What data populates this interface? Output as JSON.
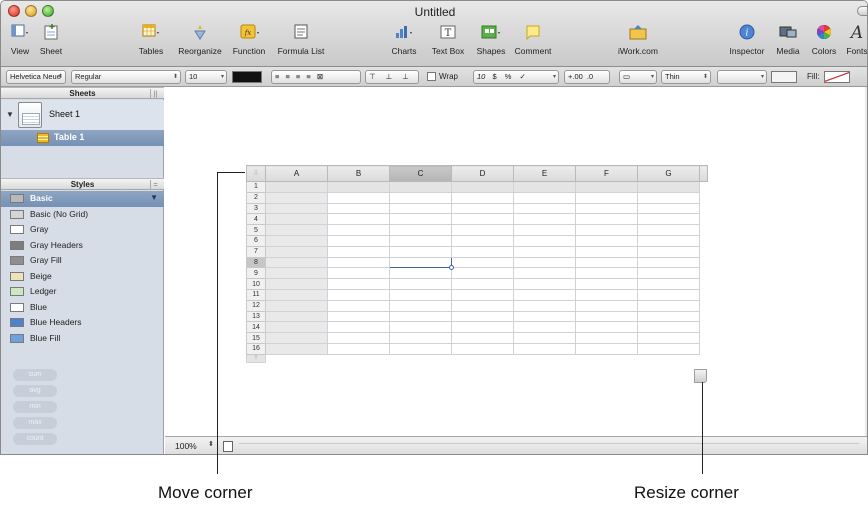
{
  "window": {
    "title": "Untitled"
  },
  "toolbar": {
    "items": [
      {
        "label": "View",
        "icon": "view-icon"
      },
      {
        "label": "Sheet",
        "icon": "sheet-icon"
      },
      {
        "label": "Tables",
        "icon": "tables-icon"
      },
      {
        "label": "Reorganize",
        "icon": "reorganize-icon"
      },
      {
        "label": "Function",
        "icon": "function-icon"
      },
      {
        "label": "Formula List",
        "icon": "formula-list-icon"
      },
      {
        "label": "Charts",
        "icon": "charts-icon"
      },
      {
        "label": "Text Box",
        "icon": "text-box-icon"
      },
      {
        "label": "Shapes",
        "icon": "shapes-icon"
      },
      {
        "label": "Comment",
        "icon": "comment-icon"
      },
      {
        "label": "iWork.com",
        "icon": "iwork-icon"
      },
      {
        "label": "Inspector",
        "icon": "inspector-icon"
      },
      {
        "label": "Media",
        "icon": "media-icon"
      },
      {
        "label": "Colors",
        "icon": "colors-icon"
      },
      {
        "label": "Fonts",
        "icon": "fonts-icon"
      }
    ],
    "text_box_glyph": "T",
    "fonts_glyph": "A",
    "function_glyph": "fx"
  },
  "formatbar": {
    "font_family": "Helvetica Neue",
    "font_style": "Regular",
    "font_size": "10",
    "wrap_label": "Wrap",
    "number_formats": [
      "10",
      "$",
      "%",
      "✓"
    ],
    "decimal_more": "+.00",
    "decimal_less": ".0",
    "stroke_label": "Thin",
    "fill_label": "Fill:"
  },
  "sidebar": {
    "sheets_header": "Sheets",
    "sheet_name": "Sheet 1",
    "table_name": "Table 1",
    "styles_header": "Styles",
    "styles": [
      {
        "label": "Basic",
        "color": "#b9b9b9"
      },
      {
        "label": "Basic (No Grid)",
        "color": "#d5d5d5"
      },
      {
        "label": "Gray",
        "color": "#ffffff"
      },
      {
        "label": "Gray Headers",
        "color": "#7d7d7d"
      },
      {
        "label": "Gray Fill",
        "color": "#8e8e8e"
      },
      {
        "label": "Beige",
        "color": "#efe2b9"
      },
      {
        "label": "Ledger",
        "color": "#cfe6c5"
      },
      {
        "label": "Blue",
        "color": "#ffffff"
      },
      {
        "label": "Blue Headers",
        "color": "#4d84c9"
      },
      {
        "label": "Blue Fill",
        "color": "#6fa2dd"
      }
    ],
    "formulas": [
      "sum",
      "avg",
      "min",
      "max",
      "count"
    ]
  },
  "table": {
    "columns": [
      "A",
      "B",
      "C",
      "D",
      "E",
      "F",
      "G"
    ],
    "rows": [
      "1",
      "2",
      "3",
      "4",
      "5",
      "6",
      "7",
      "8",
      "9",
      "10",
      "11",
      "12",
      "13",
      "14",
      "15",
      "16"
    ],
    "selected_column": "C",
    "selected_row": "8"
  },
  "statusbar": {
    "zoom": "100%"
  },
  "callouts": {
    "move_corner": "Move corner",
    "resize_corner": "Resize corner"
  }
}
